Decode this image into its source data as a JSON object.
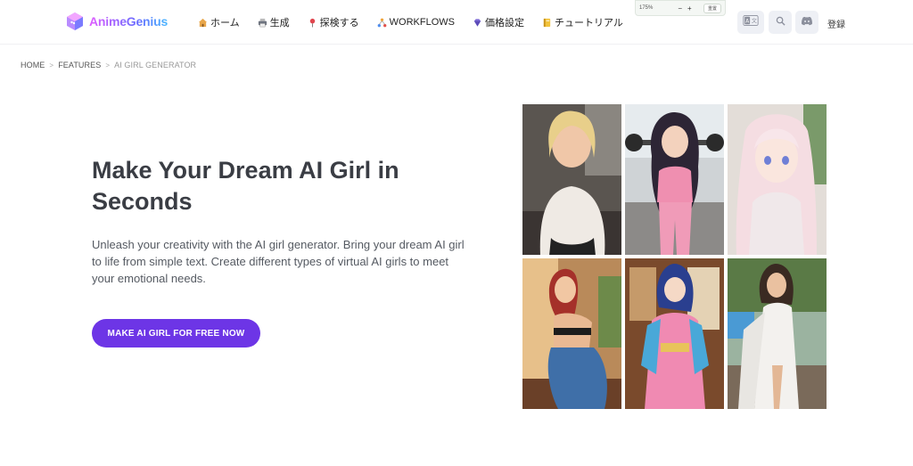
{
  "header": {
    "logo_text": "AnimeGenius",
    "nav": [
      {
        "label": "ホーム",
        "icon": "house-icon"
      },
      {
        "label": "生成",
        "icon": "printer-icon"
      },
      {
        "label": "探検する",
        "icon": "pin-icon"
      },
      {
        "label": "WORKFLOWS",
        "icon": "workflow-icon"
      },
      {
        "label": "価格設定",
        "icon": "gem-icon"
      },
      {
        "label": "チュートリアル",
        "icon": "notebook-icon"
      }
    ],
    "zoom": {
      "level": "175%",
      "minus": "−",
      "plus": "+",
      "reset_label": "重置"
    },
    "lang_icon": "translate-icon",
    "search_icon": "search-icon",
    "discord_icon": "discord-icon",
    "login_label": "登録"
  },
  "breadcrumb": {
    "items": [
      "HOME",
      "FEATURES",
      "AI GIRL GENERATOR"
    ],
    "separator": ">"
  },
  "hero": {
    "title": "Make Your Dream AI Girl in Seconds",
    "description": "Unleash your creativity with the AI girl generator. Bring your dream AI girl to life from simple text. Create different types of virtual AI girls to meet your emotional needs.",
    "cta_label": "MAKE AI GIRL FOR FREE NOW"
  },
  "colors": {
    "accent": "#6d35e6",
    "title": "#3a3d44",
    "text": "#555a62"
  }
}
